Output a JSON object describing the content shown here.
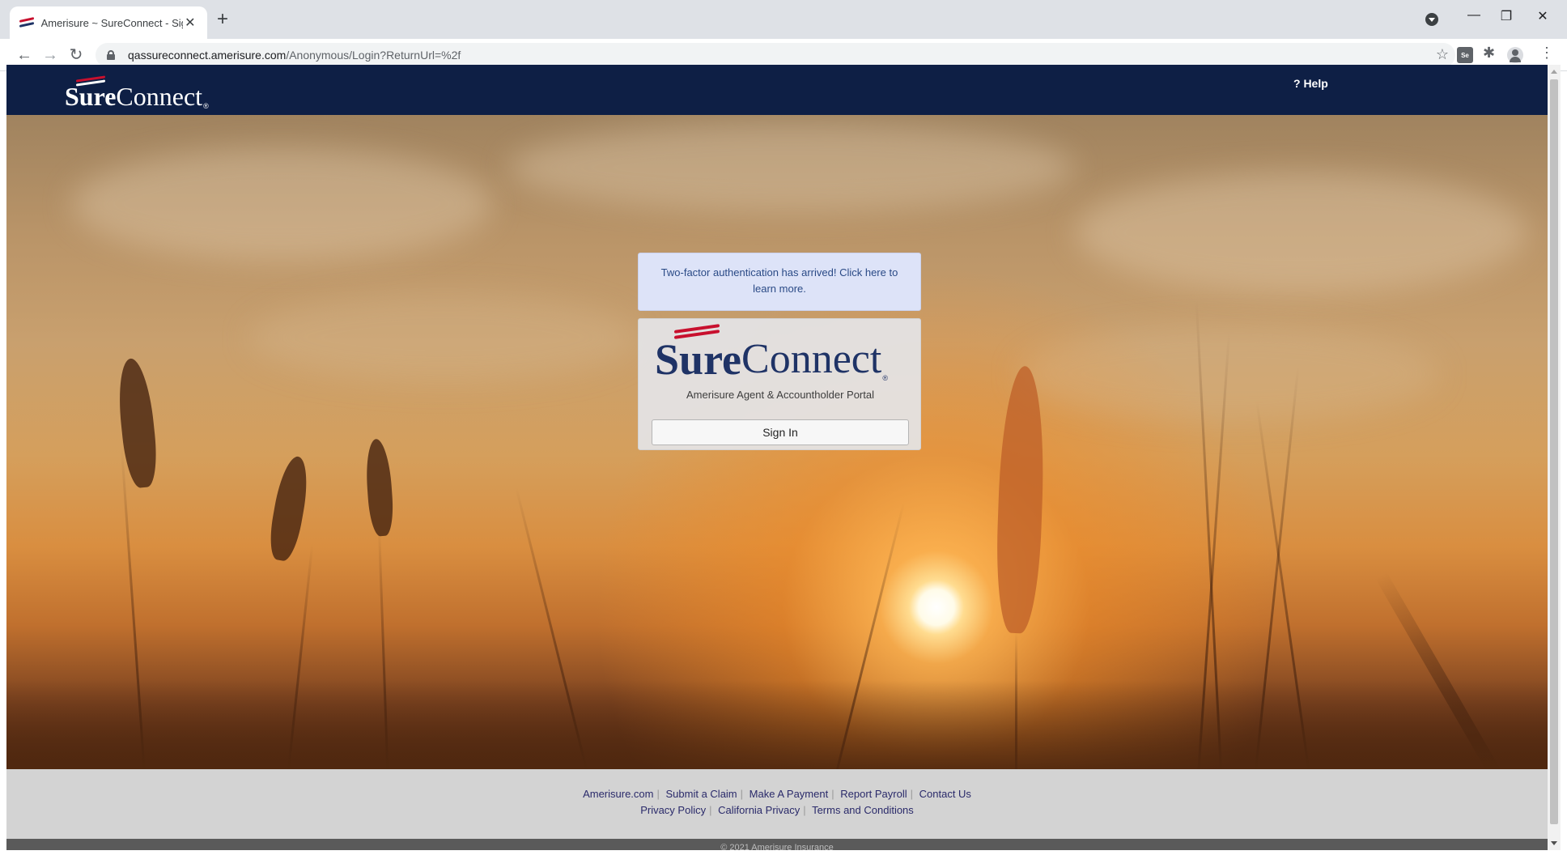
{
  "browser": {
    "tab_title": "Amerisure ~ SureConnect - Sign In",
    "tab_close": "✕",
    "new_tab": "+",
    "back": "←",
    "forward": "→",
    "reload": "↻",
    "url_host": "qassureconnect.amerisure.com",
    "url_path": "/Anonymous/Login?ReturnUrl=%2f",
    "bookmark_star": "☆",
    "ext_se_label": "Se",
    "puzzle": "✱",
    "menu": "⋮",
    "minimize": "—",
    "maximize": "❐",
    "close": "✕"
  },
  "header": {
    "logo_sure": "Sure",
    "logo_connect": "Connect",
    "logo_reg": "®",
    "help_label": "? Help"
  },
  "notice": {
    "text": "Two-factor authentication has arrived! Click here to learn more."
  },
  "card": {
    "logo_sure": "Sure",
    "logo_connect": "Connect",
    "logo_reg": "®",
    "subtitle": "Amerisure Agent & Accountholder Portal",
    "signin_label": "Sign In"
  },
  "footer": {
    "row1": [
      "Amerisure.com",
      "Submit a Claim",
      "Make A Payment",
      "Report Payroll",
      "Contact Us"
    ],
    "row2": [
      "Privacy Policy",
      "California Privacy",
      "Terms and Conditions"
    ],
    "separator": "|",
    "copyright": "© 2021 Amerisure Insurance"
  },
  "colors": {
    "header_bg": "#0e1f45",
    "flag_red": "#c8102e",
    "notice_bg": "#dde3f8",
    "footer_bg": "#d3d3d3"
  }
}
